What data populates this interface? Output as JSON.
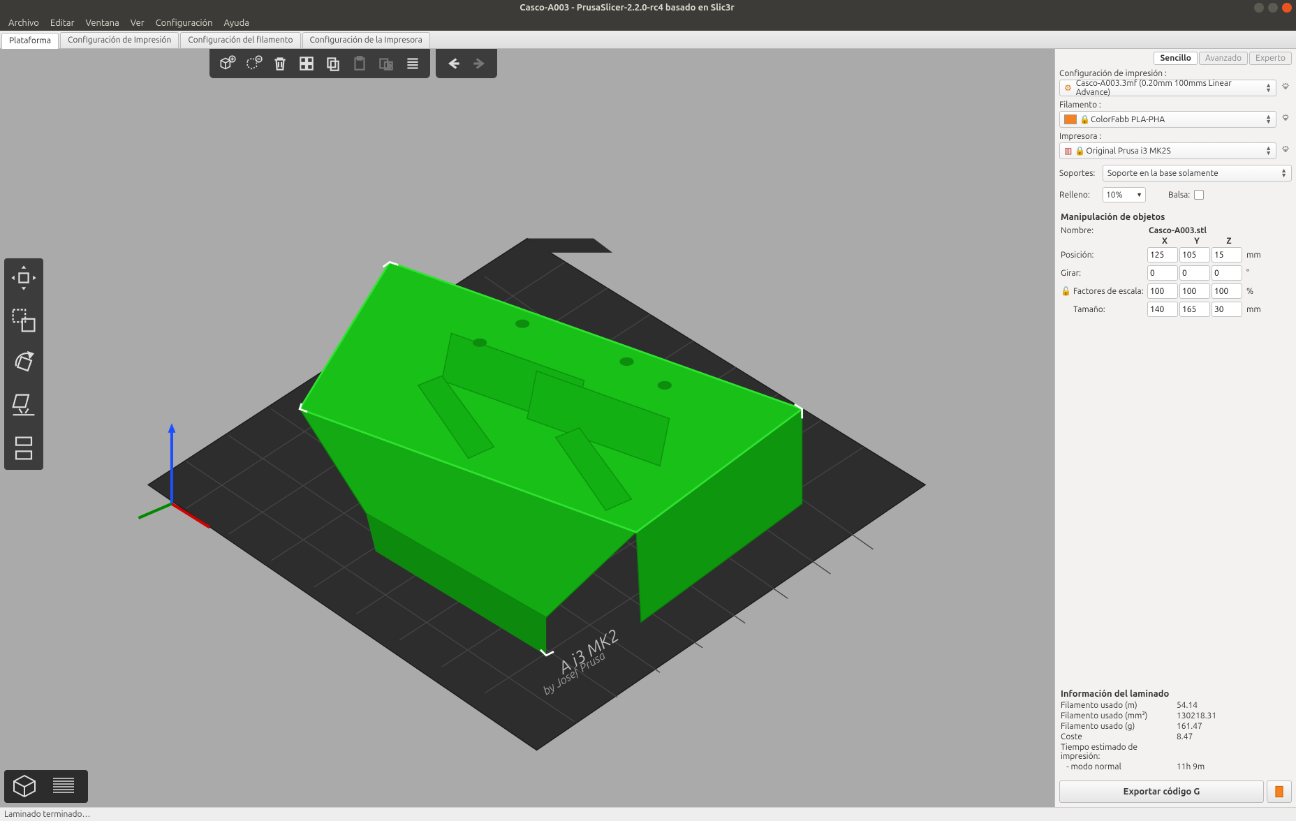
{
  "window": {
    "title": "Casco-A003 - PrusaSlicer-2.2.0-rc4 basado en Slic3r"
  },
  "menu": {
    "archivo": "Archivo",
    "editar": "Editar",
    "ventana": "Ventana",
    "ver": "Ver",
    "config": "Configuración",
    "ayuda": "Ayuda"
  },
  "tabs": {
    "plataforma": "Plataforma",
    "impresion": "Configuración de Impresión",
    "filamento": "Configuración del filamento",
    "impresora": "Configuración de la Impresora"
  },
  "modes": {
    "sencillo": "Sencillo",
    "avanzado": "Avanzado",
    "experto": "Experto"
  },
  "sidebar": {
    "config_label": "Configuración de impresión :",
    "config_value": "Casco-A003.3mf (0.20mm 100mms Linear Advance)",
    "filamento_label": "Filamento :",
    "filamento_value": "ColorFabb PLA-PHA",
    "impresora_label": "Impresora :",
    "impresora_value": "Original Prusa i3 MK2S",
    "soportes_label": "Soportes:",
    "soportes_value": "Soporte en la base solamente",
    "relleno_label": "Relleno:",
    "relleno_value": "10%",
    "balsa_label": "Balsa:"
  },
  "obj": {
    "header": "Manipulación de objetos",
    "name_label": "Nombre:",
    "name_value": "Casco-A003.stl",
    "xh": "X",
    "yh": "Y",
    "zh": "Z",
    "pos_label": "Posición:",
    "pos": {
      "x": "125",
      "y": "105",
      "z": "15",
      "unit": "mm"
    },
    "rot_label": "Girar:",
    "rot": {
      "x": "0",
      "y": "0",
      "z": "0",
      "unit": "°"
    },
    "scale_label": "Factores de escala:",
    "scale": {
      "x": "100",
      "y": "100",
      "z": "100",
      "unit": "%"
    },
    "size_label": "Tamaño:",
    "size": {
      "x": "140",
      "y": "165",
      "z": "30",
      "unit": "mm"
    }
  },
  "info": {
    "header": "Información del laminado",
    "fil_m_label": "Filamento usado (m)",
    "fil_m": "54.14",
    "fil_mm3_label": "Filamento usado (mm³)",
    "fil_mm3": "130218.31",
    "fil_g_label": "Filamento usado (g)",
    "fil_g": "161.47",
    "coste_label": "Coste",
    "coste": "8.47",
    "time_label": "Tiempo estimado de impresión:",
    "time_mode_label": "   - modo normal",
    "time_mode": "11h 9m"
  },
  "export_label": "Exportar código G",
  "status": "Laminado terminado…",
  "bed_label1": "A i3 MK2",
  "bed_label2": "by Josef Prusa"
}
